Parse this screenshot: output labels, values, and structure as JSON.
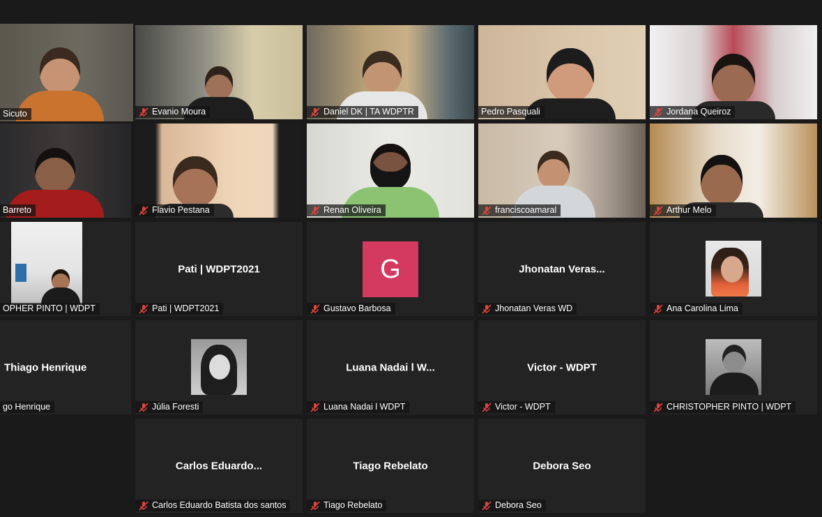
{
  "participants": [
    {
      "label": "Sicuto",
      "video": true,
      "active": true
    },
    {
      "label": "Evanio Moura",
      "video": true
    },
    {
      "label": "Daniel DK | TA WDPTR",
      "video": true
    },
    {
      "label": "Pedro Pasquali",
      "video": true
    },
    {
      "label": "Jordana Queiroz",
      "video": true
    },
    {
      "label": "Barreto",
      "video": true
    },
    {
      "label": "Flavio Pestana",
      "video": true
    },
    {
      "label": "Renan Oliveira",
      "video": true
    },
    {
      "label": "franciscoamaral",
      "video": true
    },
    {
      "label": "Arthur Melo",
      "video": true
    },
    {
      "label": "OPHER PINTO | WDPT",
      "video": true
    },
    {
      "label": "Pati | WDPT2021",
      "display_name": "Pati | WDPT2021"
    },
    {
      "label": "Gustavo Barbosa",
      "avatar_letter": "G"
    },
    {
      "label": "Jhonatan Veras WD",
      "display_name": "Jhonatan  Veras..."
    },
    {
      "label": "Ana Carolina Lima",
      "avatar_photo": true
    },
    {
      "label": "go Henrique",
      "display_name": "Thiago Henrique"
    },
    {
      "label": "Júlia Foresti",
      "avatar_photo": true
    },
    {
      "label": "Luana Nadai l WDPT",
      "display_name": "Luana  Nadai  l  W..."
    },
    {
      "label": "Victor - WDPT",
      "display_name": "Victor  -  WDPT"
    },
    {
      "label": "CHRISTOPHER PINTO | WDPT",
      "avatar_photo": true
    },
    {
      "label": "Carlos Eduardo Batista dos santos",
      "display_name": "Carlos  Eduardo..."
    },
    {
      "label": "Tiago Rebelato",
      "display_name": "Tiago Rebelato"
    },
    {
      "label": "Debora Seo",
      "display_name": "Debora Seo"
    }
  ],
  "colors": {
    "background": "#1a1a1a",
    "tile": "#232323",
    "active_speaker_border": "#d6d93a",
    "muted_mic": "#e0443e",
    "avatar_g": "#d4395f"
  },
  "icons": {
    "mute": "muted-microphone-icon"
  }
}
